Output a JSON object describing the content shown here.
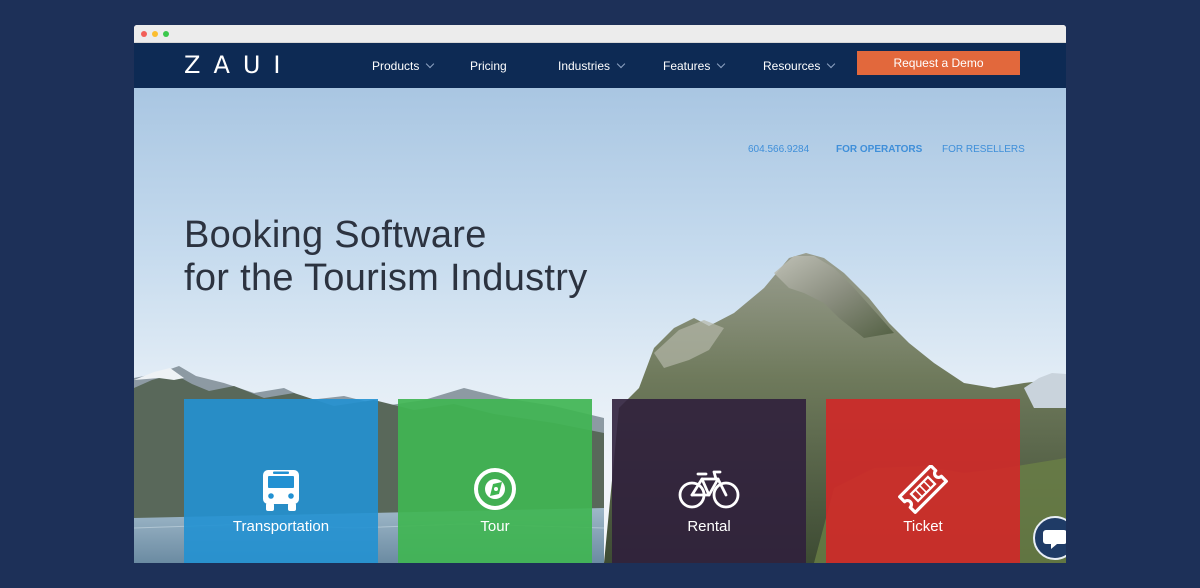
{
  "colors": {
    "page_bg": "#1d3058",
    "nav_bg": "#0d2a54",
    "demo_button": "#e2683c",
    "link_blue": "#3f8fd9",
    "tile_transportation": "#2291d2",
    "tile_tour": "#40b552",
    "tile_rental": "#30203c",
    "tile_ticket": "#d22828"
  },
  "brand": {
    "logo": "ZAUI"
  },
  "nav": {
    "items": [
      {
        "label": "Products",
        "dropdown": true
      },
      {
        "label": "Pricing",
        "dropdown": false
      },
      {
        "label": "Industries",
        "dropdown": true
      },
      {
        "label": "Features",
        "dropdown": true
      },
      {
        "label": "Resources",
        "dropdown": true
      }
    ],
    "cta": "Request a Demo"
  },
  "topbar": {
    "phone": "604.566.9284",
    "for_operators": "FOR OPERATORS",
    "for_resellers": "FOR RESELLERS"
  },
  "hero": {
    "headline_line1": "Booking Software",
    "headline_line2": "for the Tourism Industry"
  },
  "tiles": [
    {
      "label": "Transportation",
      "icon": "bus-icon"
    },
    {
      "label": "Tour",
      "icon": "compass-icon"
    },
    {
      "label": "Rental",
      "icon": "bicycle-icon"
    },
    {
      "label": "Ticket",
      "icon": "ticket-icon"
    }
  ],
  "chat": {
    "icon": "chat-bubble-icon"
  }
}
